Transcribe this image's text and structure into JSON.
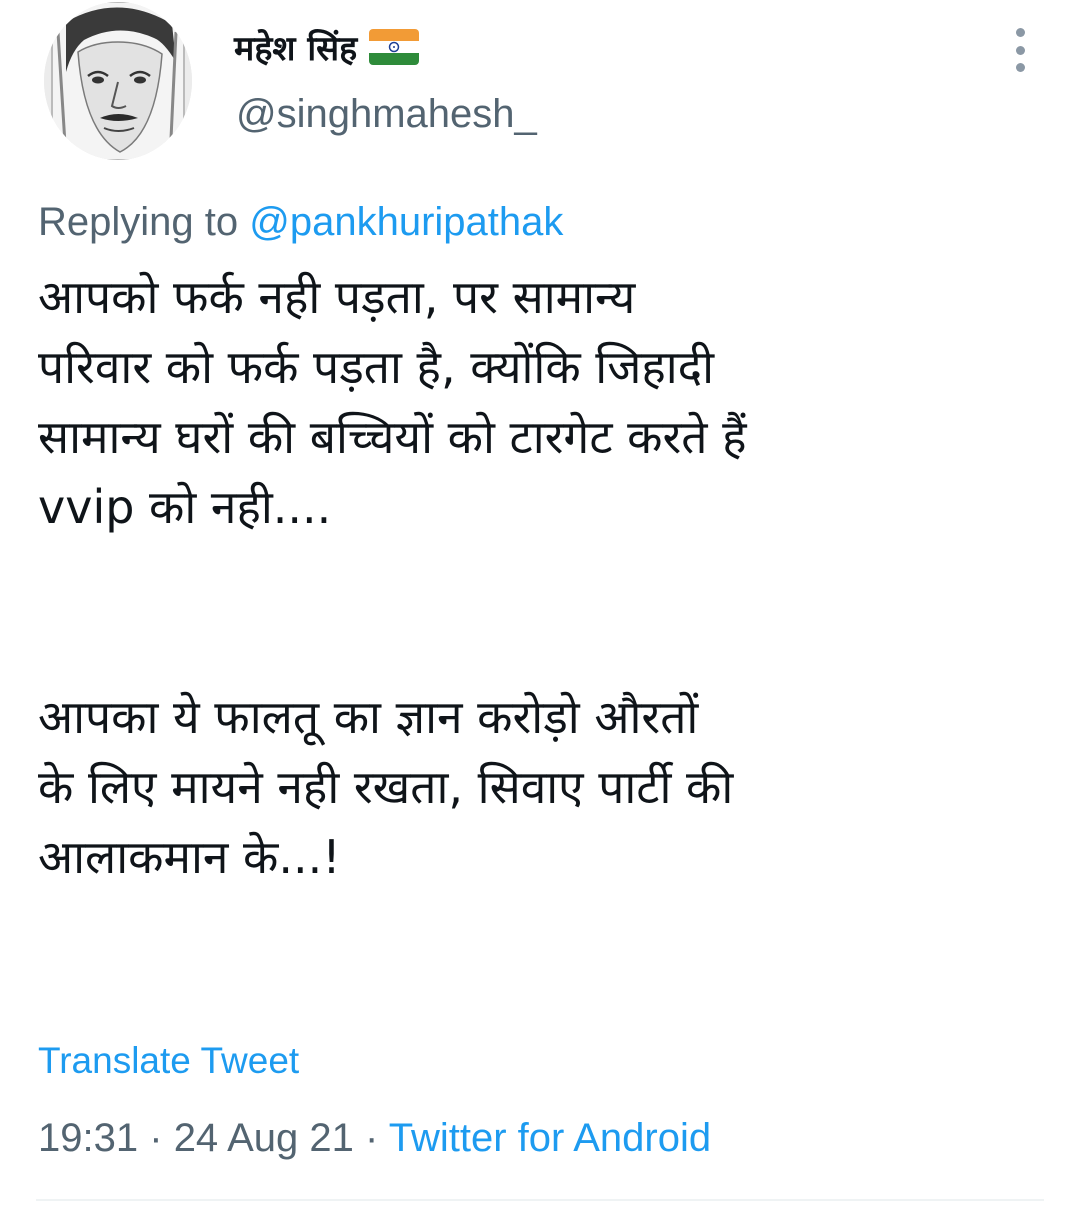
{
  "author": {
    "display_name": "महेश सिंह",
    "flag_icon": "india-flag-icon",
    "handle": "@singhmahesh_"
  },
  "reply": {
    "prefix": "Replying to",
    "mention": "@pankhuripathak"
  },
  "tweet": {
    "lines": [
      "आपको फर्क नही पड़ता, पर सामान्य",
      "परिवार को फर्क पड़ता है, क्योंकि जिहादी",
      "सामान्य घरों की बच्चियों को टारगेट करते हैं",
      "vvip को नही....",
      "आपका ये फालतू का ज्ञान करोड़ो औरतों",
      "के लिए मायने नही रखता, सिवाए पार्टी की",
      "आलाकमान के...!"
    ]
  },
  "actions": {
    "translate_label": "Translate Tweet"
  },
  "meta": {
    "time": "19:31",
    "separator": "·",
    "date": "24 Aug 21",
    "source": "Twitter for Android"
  },
  "colors": {
    "link": "#1d9bf0",
    "secondary_text": "#536471",
    "primary_text": "#0f1419"
  }
}
